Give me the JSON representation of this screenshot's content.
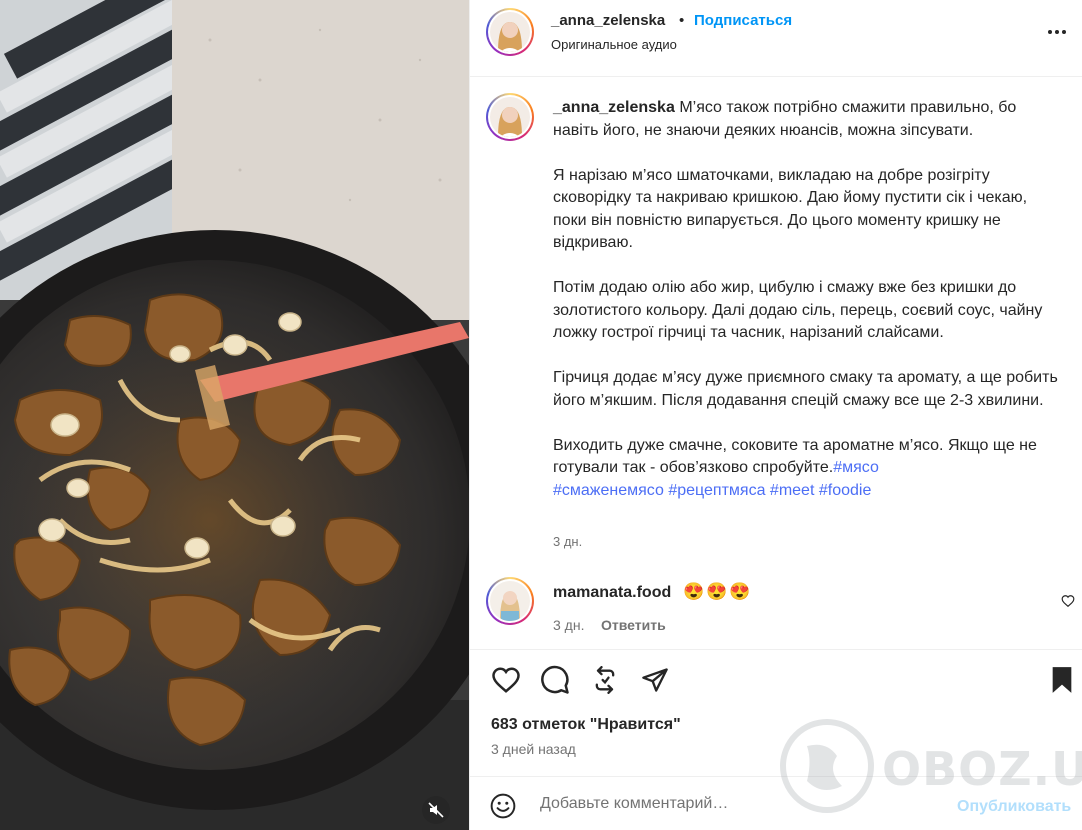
{
  "post": {
    "username": "_anna_zelenska",
    "dot": "•",
    "follow_label": "Подписаться",
    "audio_label": "Оригинальное аудио"
  },
  "caption": {
    "username": "_anna_zelenska",
    "paragraph_1": "М’ясо також потрібно смажити правильно, бо навіть його, не знаючи деяких нюансів, можна зіпсувати.",
    "paragraph_2": "Я нарізаю м’ясо шматочками, викладаю на добре розігріту сковорідку та накриваю кришкою. Даю йому пустити сік і чекаю, поки він повністю випарується. До цього моменту кришку не відкриваю.",
    "paragraph_3": "Потім додаю олію або жир, цибулю і смажу вже без кришки до золотистого кольору. Далі додаю сіль, перець, соєвий соус, чайну ложку гострої гірчиці та часник, нарізаний слайсами.",
    "paragraph_4": "Гірчиця додає м’ясу дуже приємного смаку та аромату, а ще робить його м’якшим. Після додавання спецій смажу все ще 2-3 хвилини.",
    "paragraph_5": "Виходить дуже смачне, соковите та ароматне м’ясо. Якщо ще не готували так - обов’язково спробуйте.",
    "hashtags": [
      "#мясо",
      "#смаженемясо",
      "#рецептмяса",
      "#meet",
      "#foodie"
    ],
    "time": "3 дн."
  },
  "comment": {
    "username": "mamanata.food",
    "text": "😍😍😍",
    "time": "3 дн.",
    "reply_label": "Ответить"
  },
  "actions": {
    "icons": [
      "heart-icon",
      "comment-icon",
      "repost-icon",
      "share-icon",
      "bookmark-icon"
    ]
  },
  "likes_text": "683 отметок \"Нравится\"",
  "posted_ago": "3 дней назад",
  "add_comment": {
    "placeholder": "Добавьте комментарий…",
    "post_label": "Опубликовать"
  },
  "watermark": "OBOZ.UA",
  "colors": {
    "link_blue": "#0095f6",
    "hashtag": "#4c6ef5",
    "muted": "#737373",
    "post_disabled": "#b2dffc"
  }
}
